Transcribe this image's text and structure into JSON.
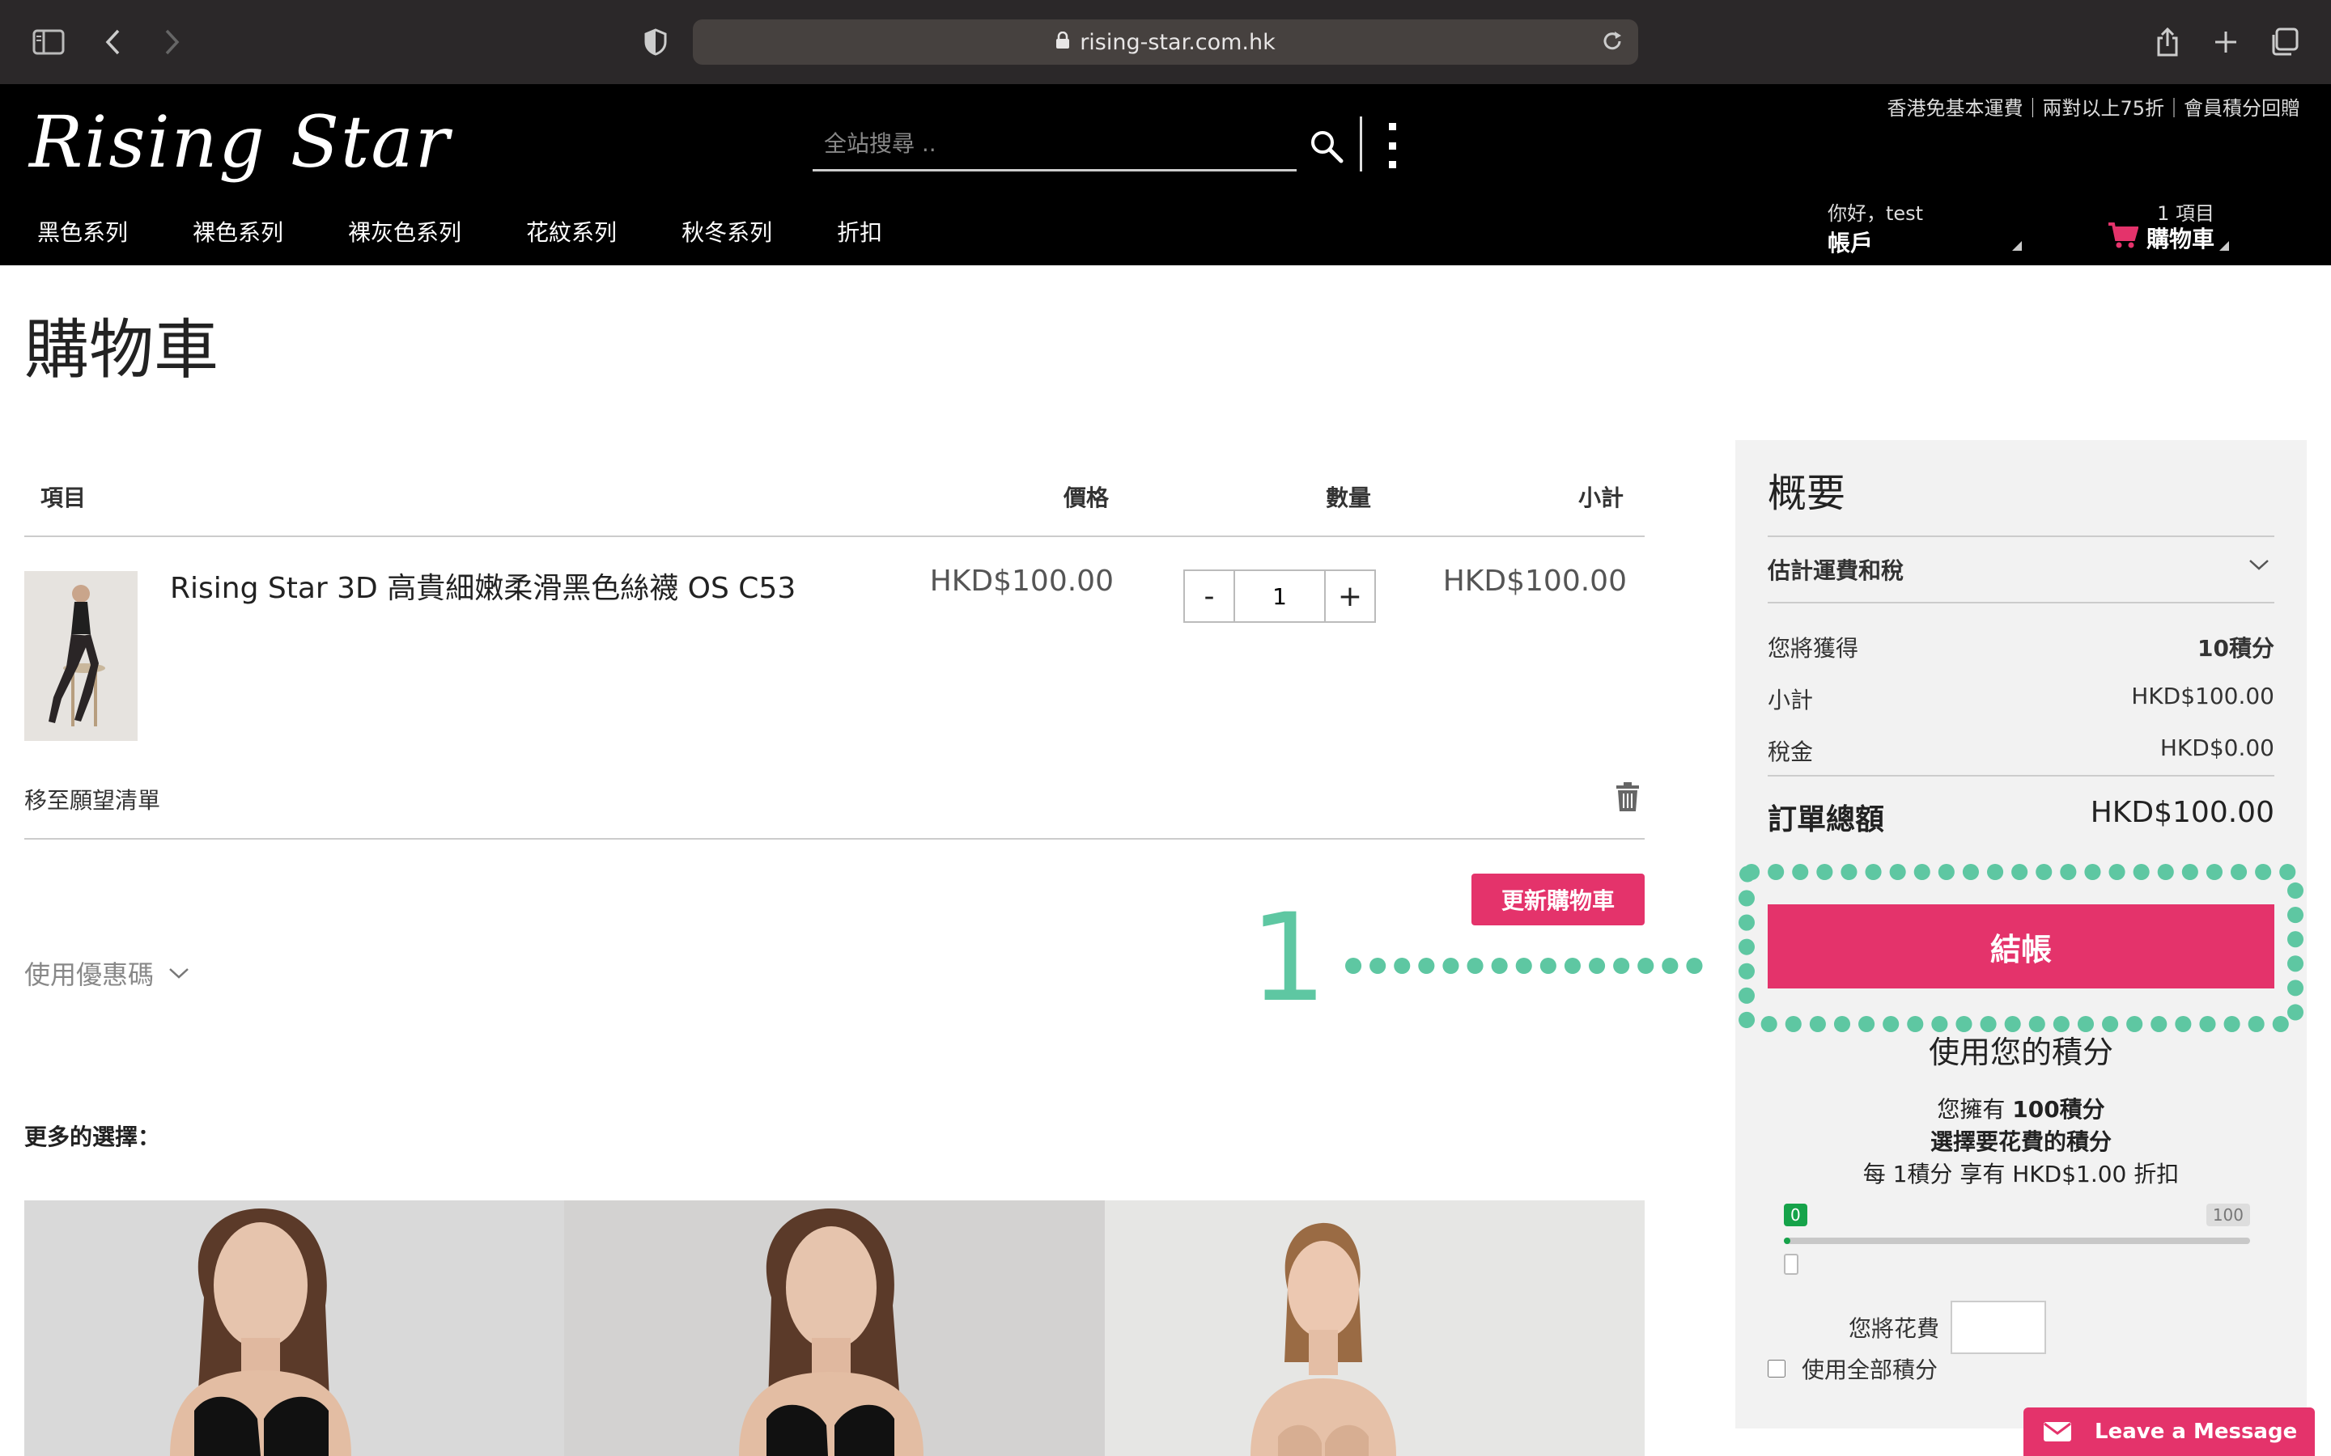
{
  "browser": {
    "url": "rising-star.com.hk"
  },
  "header": {
    "logo": "Rising Star",
    "promo": "香港免基本運費｜兩對以上75折｜會員積分回贈",
    "search_placeholder": "全站搜尋 ..",
    "nav": [
      "黑色系列",
      "裸色系列",
      "裸灰色系列",
      "花紋系列",
      "秋冬系列",
      "折扣"
    ],
    "account": {
      "greeting": "你好，test",
      "label": "帳戶"
    },
    "cart": {
      "count": "1 項目",
      "label": "購物車"
    }
  },
  "page": {
    "title": "購物車",
    "columns": {
      "item": "項目",
      "price": "價格",
      "qty": "數量",
      "subtotal": "小計"
    },
    "item": {
      "name": "Rising Star 3D 高貴細嫩柔滑黑色絲襪 OS C53",
      "price": "HKD$100.00",
      "qty": "1",
      "subtotal": "HKD$100.00",
      "wishlist": "移至願望清單"
    },
    "qty_minus": "-",
    "qty_plus": "+",
    "update_cart": "更新購物車",
    "coupon": "使用優惠碼",
    "annotation_number": "1",
    "more_choices": "更多的選擇："
  },
  "summary": {
    "title": "概要",
    "shipping": "估計運費和稅",
    "earn_label": "您將獲得",
    "earn_value": "10積分",
    "subtotal_label": "小計",
    "subtotal_value": "HKD$100.00",
    "tax_label": "稅金",
    "tax_value": "HKD$0.00",
    "total_label": "訂單總額",
    "total_value": "HKD$100.00",
    "checkout": "結帳",
    "points": {
      "title": "使用您的積分",
      "have_prefix": "您擁有",
      "have_value": "100積分",
      "choose": "選擇要花費的積分",
      "rate": "每 1積分 享有 HKD$1.00 折扣",
      "slider_min": "0",
      "slider_max": "100",
      "slider_value": 0,
      "spend_label": "您將花費",
      "use_all": "使用全部積分"
    }
  },
  "chat": {
    "label": "Leave a Message"
  },
  "colors": {
    "accent": "#e4336b",
    "annotation": "#5ec7a2",
    "header_bg": "#000000"
  }
}
